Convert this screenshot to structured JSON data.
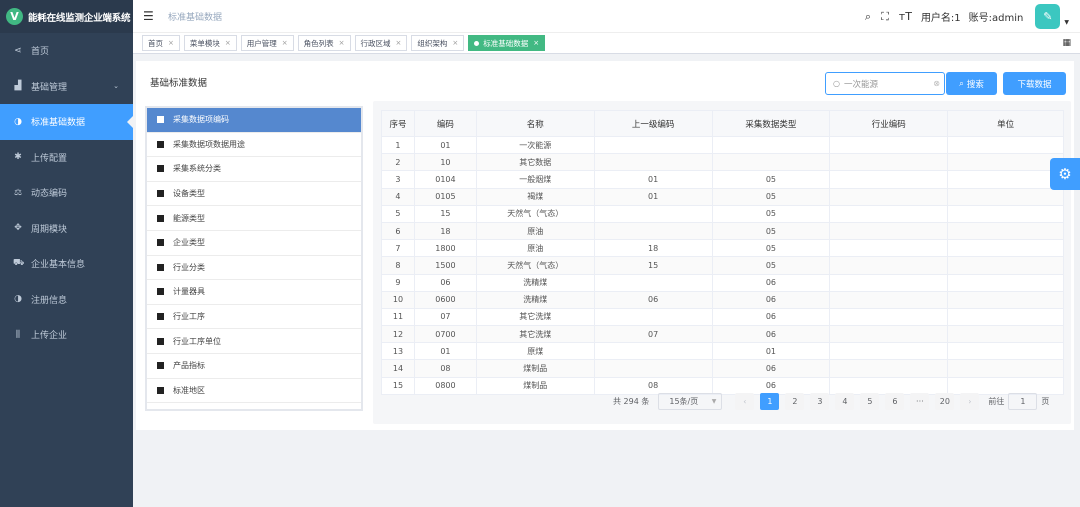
{
  "app": {
    "title": "能耗在线监测企业端系统",
    "logo_letter": "V"
  },
  "sidebar": {
    "items": [
      {
        "label": "首页",
        "icon": "share-icon",
        "glyph": "⋖"
      },
      {
        "label": "基础管理",
        "icon": "chart-icon",
        "glyph": "▟",
        "arrow": "⌄"
      },
      {
        "label": "标准基础数据",
        "icon": "half-circle-icon",
        "glyph": "◑"
      },
      {
        "label": "上传配置",
        "icon": "asterisk-icon",
        "glyph": "✱"
      },
      {
        "label": "动态编码",
        "icon": "scale-icon",
        "glyph": "⚖"
      },
      {
        "label": "周期模块",
        "icon": "move-icon",
        "glyph": "✥"
      },
      {
        "label": "企业基本信息",
        "icon": "car-icon",
        "glyph": "⛟"
      },
      {
        "label": "注册信息",
        "icon": "half-circle-icon",
        "glyph": "◑"
      },
      {
        "label": "上传企业",
        "icon": "bars-icon",
        "glyph": "⫼"
      }
    ]
  },
  "navbar": {
    "breadcrumb": "标准基础数据",
    "username": "用户名:1",
    "account": "账号:admin"
  },
  "tags": [
    {
      "label": "首页"
    },
    {
      "label": "菜单模块"
    },
    {
      "label": "用户管理"
    },
    {
      "label": "角色列表"
    },
    {
      "label": "行政区域"
    },
    {
      "label": "组织架构"
    },
    {
      "label": "标准基础数据"
    }
  ],
  "page": {
    "title": "基础标准数据",
    "search_value": "一次能源",
    "search_button": "搜索",
    "download_button": "下载数据"
  },
  "categories": [
    "采集数据项编码",
    "采集数据项数据用途",
    "采集系统分类",
    "设备类型",
    "能源类型",
    "企业类型",
    "行业分类",
    "计量器具",
    "行业工序",
    "行业工序单位",
    "产品指标",
    "标准地区"
  ],
  "table": {
    "headers": [
      "序号",
      "编码",
      "名称",
      "上一级编码",
      "采集数据类型",
      "行业编码",
      "单位"
    ],
    "rows": [
      [
        "1",
        "01",
        "一次能源",
        "",
        "",
        "",
        ""
      ],
      [
        "2",
        "10",
        "其它数据",
        "",
        "",
        "",
        ""
      ],
      [
        "3",
        "0104",
        "一般烟煤",
        "01",
        "05",
        "",
        ""
      ],
      [
        "4",
        "0105",
        "褐煤",
        "01",
        "05",
        "",
        ""
      ],
      [
        "5",
        "15",
        "天然气（气态）",
        "",
        "05",
        "",
        ""
      ],
      [
        "6",
        "18",
        "原油",
        "",
        "05",
        "",
        ""
      ],
      [
        "7",
        "1800",
        "原油",
        "18",
        "05",
        "",
        ""
      ],
      [
        "8",
        "1500",
        "天然气（气态）",
        "15",
        "05",
        "",
        ""
      ],
      [
        "9",
        "06",
        "洗精煤",
        "",
        "06",
        "",
        ""
      ],
      [
        "10",
        "0600",
        "洗精煤",
        "06",
        "06",
        "",
        ""
      ],
      [
        "11",
        "07",
        "其它洗煤",
        "",
        "06",
        "",
        ""
      ],
      [
        "12",
        "0700",
        "其它洗煤",
        "07",
        "06",
        "",
        ""
      ],
      [
        "13",
        "01",
        "原煤",
        "",
        "01",
        "",
        ""
      ],
      [
        "14",
        "08",
        "煤制品",
        "",
        "06",
        "",
        ""
      ],
      [
        "15",
        "0800",
        "煤制品",
        "08",
        "06",
        "",
        ""
      ]
    ]
  },
  "pagination": {
    "total": "共 294 条",
    "page_size": "15条/页",
    "pages": [
      "1",
      "2",
      "3",
      "4",
      "5",
      "6",
      "···",
      "20"
    ],
    "goto_label": "前往",
    "goto_value": "1",
    "goto_suffix": "页"
  },
  "colors": {
    "primary": "#409eff",
    "sidebar": "#304156",
    "tag_active": "#42b983"
  }
}
